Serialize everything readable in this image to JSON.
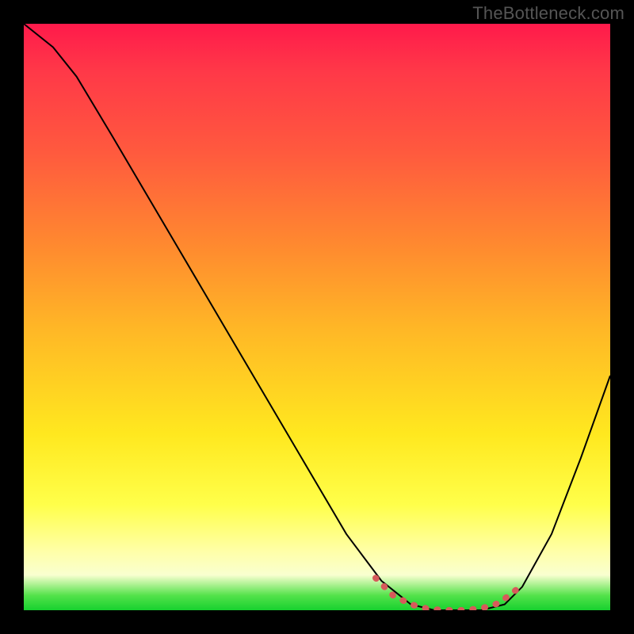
{
  "watermark": "TheBottleneck.com",
  "chart_data": {
    "type": "line",
    "title": "",
    "xlabel": "",
    "ylabel": "",
    "xlim": [
      0,
      1
    ],
    "ylim": [
      0,
      1
    ],
    "grid": false,
    "legend": false,
    "background_gradient": {
      "direction": "vertical",
      "stops": [
        {
          "pos": 0.0,
          "color": "#ff1a4b"
        },
        {
          "pos": 0.08,
          "color": "#ff3848"
        },
        {
          "pos": 0.22,
          "color": "#ff5a3e"
        },
        {
          "pos": 0.38,
          "color": "#ff8a2f"
        },
        {
          "pos": 0.52,
          "color": "#ffb726"
        },
        {
          "pos": 0.7,
          "color": "#ffe81f"
        },
        {
          "pos": 0.82,
          "color": "#ffff4a"
        },
        {
          "pos": 0.9,
          "color": "#ffffa8"
        },
        {
          "pos": 0.94,
          "color": "#f9ffd0"
        },
        {
          "pos": 0.975,
          "color": "#53e24a"
        },
        {
          "pos": 1.0,
          "color": "#17d12f"
        }
      ]
    },
    "series": [
      {
        "name": "bottleneck-curve",
        "color": "#000000",
        "stroke_width": 2,
        "x": [
          0.0,
          0.05,
          0.09,
          0.15,
          0.25,
          0.35,
          0.45,
          0.55,
          0.61,
          0.66,
          0.7,
          0.74,
          0.78,
          0.82,
          0.85,
          0.9,
          0.95,
          1.0
        ],
        "y": [
          1.0,
          0.96,
          0.91,
          0.81,
          0.64,
          0.47,
          0.3,
          0.13,
          0.05,
          0.01,
          0.0,
          0.0,
          0.0,
          0.01,
          0.04,
          0.13,
          0.26,
          0.4
        ]
      },
      {
        "name": "valley-highlight",
        "color": "#d75a5a",
        "stroke_width": 8,
        "linecap": "round",
        "x": [
          0.6,
          0.63,
          0.66,
          0.69,
          0.72,
          0.75,
          0.78,
          0.81,
          0.84
        ],
        "y": [
          0.055,
          0.025,
          0.01,
          0.002,
          0.0,
          0.0,
          0.003,
          0.012,
          0.035
        ]
      }
    ]
  }
}
